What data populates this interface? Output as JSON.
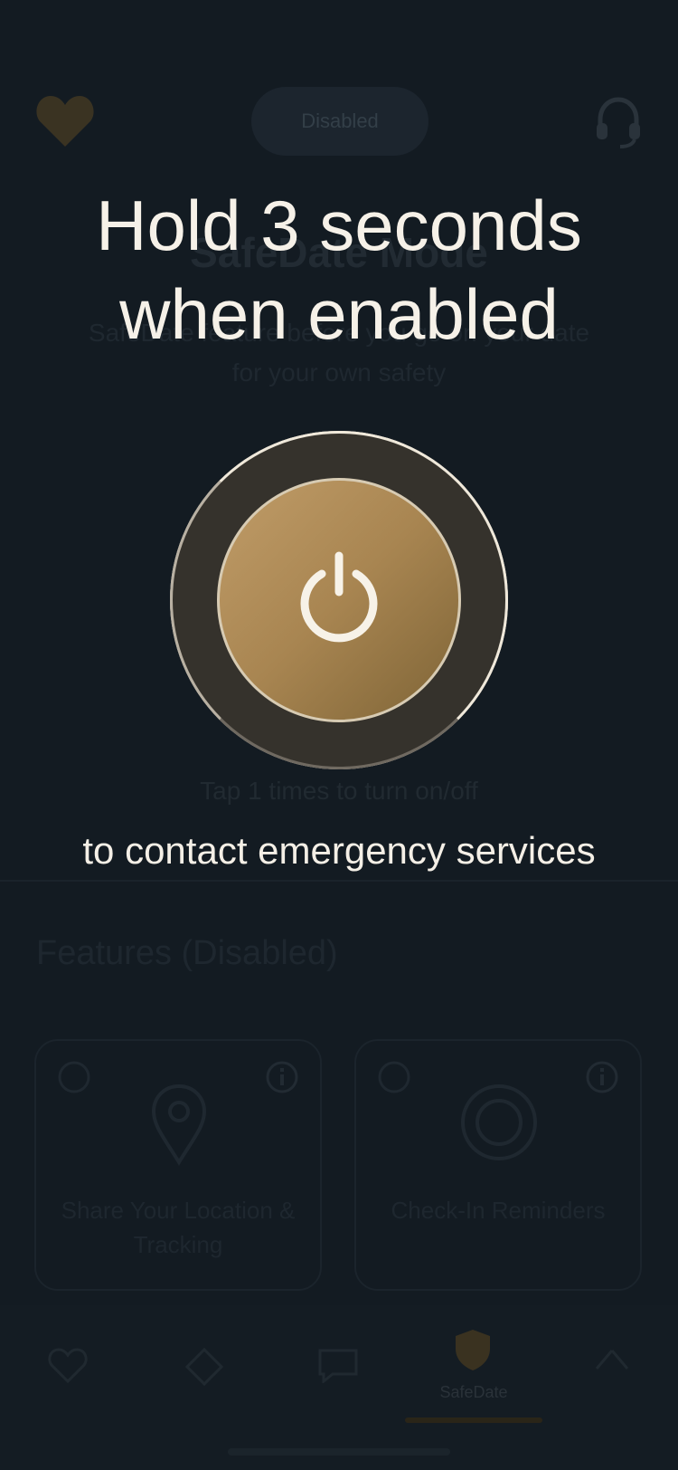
{
  "background": {
    "status_pill": "Disabled",
    "title": "SafeDate Mode",
    "subtitle": "SafeDate feature before you go on your date for your own safety",
    "tap_hint": "Tap 1 times to turn on/off",
    "features_title": "Features (Disabled)",
    "feature_cards": [
      {
        "label": "Share Your Location & Tracking"
      },
      {
        "label": "Check-In Reminders"
      }
    ],
    "tabbar": {
      "active_tab_label": "SafeDate"
    }
  },
  "overlay": {
    "title_line1": "Hold 3 seconds",
    "title_line2": "when enabled",
    "caption": "to contact emergency services",
    "accent_color": "#b08d57",
    "text_color": "#f6f1e8"
  }
}
